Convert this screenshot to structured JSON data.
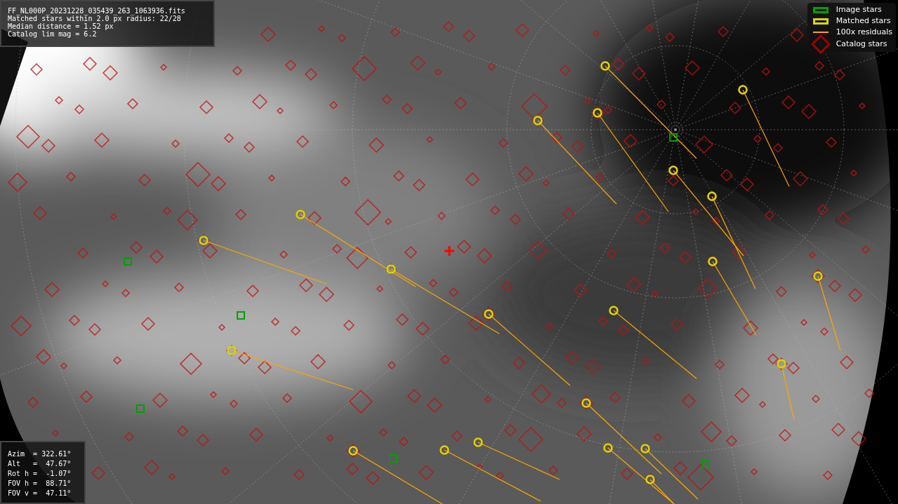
{
  "info_panel": {
    "lines": [
      "FF_NL000P_20231228_035439_263_1063936.fits",
      "Matched stars within 2.0 px radius: 22/28",
      "Median distance = 1.52 px",
      "Catalog lim mag = 6.2"
    ]
  },
  "legend": [
    {
      "kind": "box",
      "color": "#00a000",
      "label": "Image stars"
    },
    {
      "kind": "box",
      "color": "#d8d800",
      "label": "Matched stars"
    },
    {
      "kind": "line",
      "color": "#ffa500",
      "label": "100x residuals"
    },
    {
      "kind": "diamond",
      "color": "#a00000",
      "label": "Catalog stars"
    }
  ],
  "pointing_panel": {
    "lines": [
      "Azim  = 322.61°",
      "Alt   =  47.67°",
      "Rot h =  -1.07°",
      "FOV h =  88.71°",
      "FOV v =  47.11°"
    ]
  }
}
